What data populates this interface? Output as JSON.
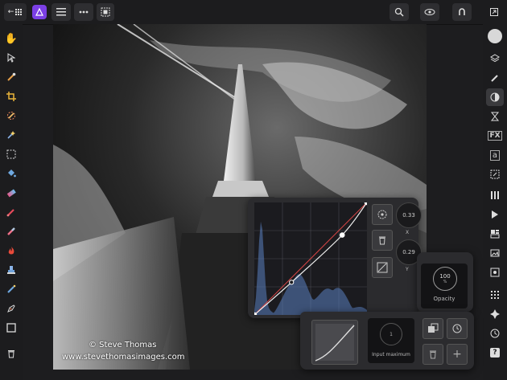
{
  "toolbar": {
    "back_label": "←",
    "icons": [
      "back-grid-icon",
      "affinity-photo-icon",
      "hamburger-menu-icon",
      "more-icon",
      "view-mode-icon",
      "zoom-icon",
      "view-eye-icon",
      "snapping-icon",
      "fullscreen-icon"
    ]
  },
  "left_tools": [
    "hand-icon",
    "move-icon",
    "color-picker-icon",
    "crop-icon",
    "selection-brush-icon",
    "flood-select-icon",
    "marquee-icon",
    "flood-fill-icon",
    "gradient-icon",
    "paint-brush-icon",
    "erase-icon",
    "burn-icon",
    "clone-icon",
    "retouch-icon",
    "pen-icon",
    "shape-icon",
    "trash-icon"
  ],
  "right_tools": [
    "color-icon",
    "layers-icon",
    "brush-panel-icon",
    "adjustments-icon",
    "history-icon",
    "fx-icon",
    "text-styles-icon",
    "transform-panel-icon",
    "channels-icon",
    "macro-icon",
    "stock-icon",
    "library-icon",
    "settings-icon",
    "snap-grid-icon",
    "navigator-icon",
    "history-clock-icon",
    "help-icon"
  ],
  "right_labels": {
    "fx": "FX",
    "text": "a",
    "help": "?"
  },
  "watermark": {
    "line1": "© Steve Thomas",
    "line2": "www.stevethomasimages.com"
  },
  "curves": {
    "x_label": "X",
    "y_label": "Y",
    "x_value": "0.33",
    "y_value": "0.29",
    "points": [
      [
        0,
        0
      ],
      [
        0.33,
        0.29
      ],
      [
        0.78,
        0.71
      ],
      [
        1,
        1
      ]
    ]
  },
  "opacity": {
    "value": "100",
    "unit": "%",
    "label": "Opacity"
  },
  "input_max": {
    "value": "1",
    "label": "Input maximum"
  },
  "add_label": "+"
}
